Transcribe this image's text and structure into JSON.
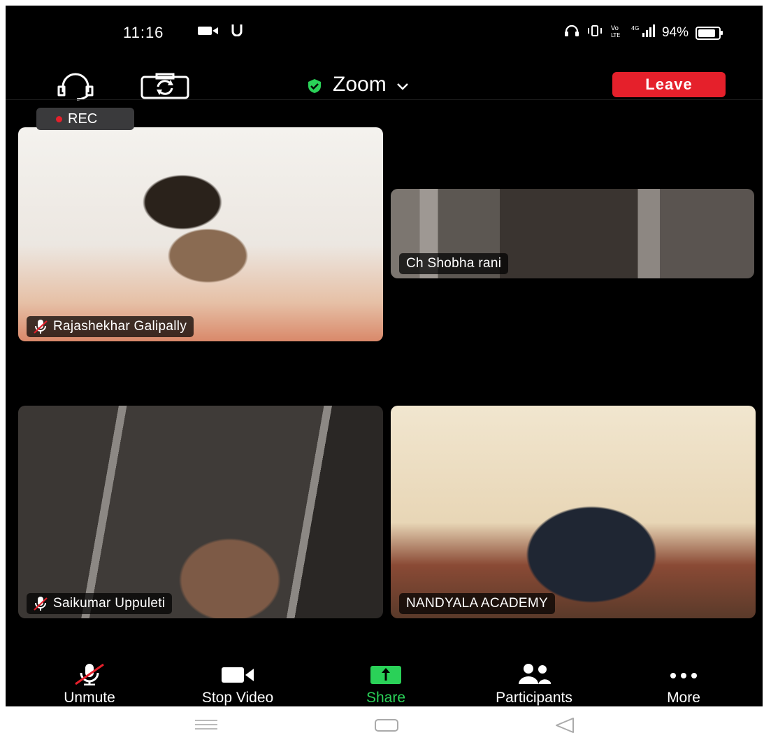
{
  "status_bar": {
    "time": "11:16",
    "left_icons": [
      "video-record-icon",
      "u-icon"
    ],
    "right_text": "94%",
    "right_icons": [
      "headset-icon",
      "vibrate-icon",
      "volte-icon",
      "4g-signal-icon",
      "battery-icon"
    ],
    "battery_level": 0.94
  },
  "header": {
    "title": "Zoom",
    "leave_label": "Leave",
    "leave_color": "#e5202b",
    "shield_color": "#2ad158"
  },
  "recording": {
    "label": "REC"
  },
  "participants": [
    {
      "name": "Rajashekhar Galipally",
      "muted": true
    },
    {
      "name": "Ch Shobha rani",
      "muted": false
    },
    {
      "name": "Saikumar Uppuleti",
      "muted": true
    },
    {
      "name": "NANDYALA ACADEMY",
      "muted": false
    }
  ],
  "toolbar": {
    "unmute": "Unmute",
    "stop_video": "Stop Video",
    "share": "Share",
    "participants": "Participants",
    "more": "More",
    "share_color": "#2ad158"
  },
  "nav_bar": {
    "icons": [
      "menu-icon",
      "home-icon",
      "back-icon"
    ]
  }
}
